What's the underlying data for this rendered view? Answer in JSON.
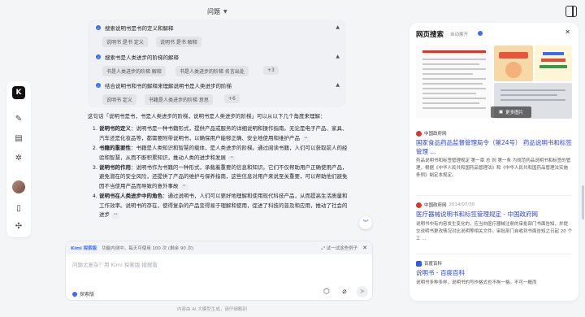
{
  "header": {
    "title": "问题"
  },
  "steps": [
    {
      "label": "搜索说明书是书的定义和解释",
      "chips": [
        "说明书 是书 定义",
        "说明书 是书 解释"
      ]
    },
    {
      "label": "搜索书是人类进步的阶梯的解释",
      "chips": [
        "书是人类进步的阶梯 解释",
        "书是人类进步的阶梯 名言出处",
        "+3"
      ]
    },
    {
      "label": "结合说明书和书的解释来理解说明书是人类进步的阶梯",
      "chips": [
        "说明书 定义",
        "书籍是人类进步的阶梯 意思",
        "+6"
      ]
    }
  ],
  "answer": {
    "intro": "这句话「说明书是书，书是人类进步的阶梯，说明书是人类进步的阶梯」可以从以下几个角度来理解：",
    "items": [
      {
        "term": "说明书的定义",
        "text": "：说明书是一种书籍形式，提供产品或服务的详细说明和操作指南。无论是电子产品、家具、汽车还是化妆品等，都需要附带说明书，以确保用户能够正确、安全地使用和维护产品",
        "cite": "¹¹"
      },
      {
        "term": "书籍的重要性",
        "text": "：书籍是人类知识和智慧的载体，是人类进步的阶梯。通过阅读书籍，人们可以获取前人的经验和智慧，从而不断积累知识，推动人类的进步和发展",
        "cite": "¹¹"
      },
      {
        "term": "说明书的作用",
        "text": "：说明书作为书籍的一种形式，承载着重要的信息和知识。它们不仅帮助用户正确使用产品，避免潜在的安全风险，还提供了产品的维护与保养指南，这些信息对用户来说至关重要，可以帮助他们避免因不当使用产品而导致的意外事故",
        "cite": "¹¹"
      },
      {
        "term": "说明书在人类进步中的角色",
        "text": "：通过说明书，人们可以更好地理解和使用现代科技产品，从而提高生活质量和工作效率。说明书的存在，使得复杂的产品变得易于理解和使用，促进了科技的普及和应用，推动了社会的进步",
        "cite": "¹¹"
      }
    ]
  },
  "composer": {
    "mode_tag": "Kimi 探索版",
    "quota": "功能内测中，每天可使用 100 次 (剩余 90 次)",
    "example_link": "试一试这些例子",
    "placeholder": "问题太复杂？用 Kimi 探索版 搜搜看",
    "mode_label": "探索版"
  },
  "disclaimer": "内容由 AI 大模型生成，请仔细甄别",
  "panel": {
    "title": "网页搜索",
    "auto_expand": "自动展开",
    "more_images": "更多图片",
    "results": [
      {
        "source": "中国政府网",
        "date": "",
        "title": "国家食品药品监督管理局令（第24号） 药品说明书和标签管理 ...",
        "snippet": "药品说明书和标签管理规定 第一章 总 则 第一条 为规范药品说明书和标签的管理，根据《中华人民共和国药品管理法》和《中华人民共和国药品管理法实施条例》制定本规定。"
      },
      {
        "source": "中国政府网",
        "date": "2014/07/30",
        "title": "医疗器械说明书和标签管理规定 - 中国政府网",
        "snippet": "说明书中有内容发生变化的，应当向医疗器械注册的审批部门书面告知，并提交说明书更改情况对比说明等相关文件。审批部门自收到书面告知之日起 20 个工 ..."
      },
      {
        "source": "百度百科",
        "date": "",
        "title": "说明书 - 百度百科",
        "snippet": "说明书多种多样，说明书的写作格式也不拘一格。不可一概而"
      }
    ]
  },
  "colors": {
    "accent": "#3b6cf6",
    "link": "#2f45c4",
    "gov_red": "#d23b2c"
  }
}
